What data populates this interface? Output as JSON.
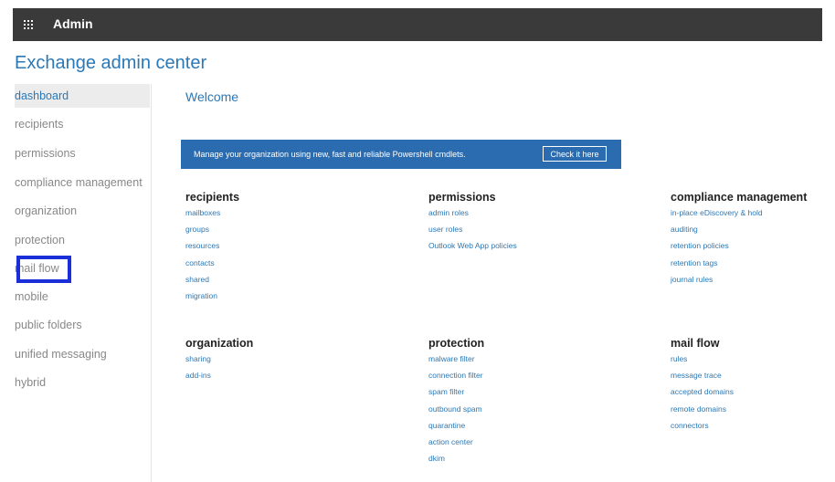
{
  "topbar": {
    "title": "Admin",
    "icon": "waffle-icon"
  },
  "app": {
    "title": "Exchange admin center"
  },
  "nav": {
    "items": [
      {
        "label": "dashboard",
        "active": true
      },
      {
        "label": "recipients"
      },
      {
        "label": "permissions"
      },
      {
        "label": "compliance management"
      },
      {
        "label": "organization"
      },
      {
        "label": "protection"
      },
      {
        "label": "mail flow",
        "highlighted": true
      },
      {
        "label": "mobile"
      },
      {
        "label": "public folders"
      },
      {
        "label": "unified messaging"
      },
      {
        "label": "hybrid"
      }
    ]
  },
  "main": {
    "welcome": "Welcome",
    "banner": {
      "text": "Manage your organization using new, fast and reliable Powershell cmdlets.",
      "button": "Check it here"
    },
    "sections": [
      {
        "title": "recipients",
        "links": [
          "mailboxes",
          "groups",
          "resources",
          "contacts",
          "shared",
          "migration"
        ]
      },
      {
        "title": "permissions",
        "links": [
          "admin roles",
          "user roles",
          "Outlook Web App policies"
        ]
      },
      {
        "title": "compliance management",
        "links": [
          "in-place eDiscovery & hold",
          "auditing",
          "retention policies",
          "retention tags",
          "journal rules"
        ]
      },
      {
        "title": "organization",
        "links": [
          "sharing",
          "add-ins"
        ]
      },
      {
        "title": "protection",
        "links": [
          "malware filter",
          "connection filter",
          "spam filter",
          "outbound spam",
          "quarantine",
          "action center",
          "dkim"
        ]
      },
      {
        "title": "mail flow",
        "links": [
          "rules",
          "message trace",
          "accepted domains",
          "remote domains",
          "connectors"
        ]
      }
    ]
  },
  "colors": {
    "topbar": "#3a3a3a",
    "accent": "#2b78b6",
    "banner": "#2b6cb0",
    "highlight": "#1a2fd8"
  }
}
